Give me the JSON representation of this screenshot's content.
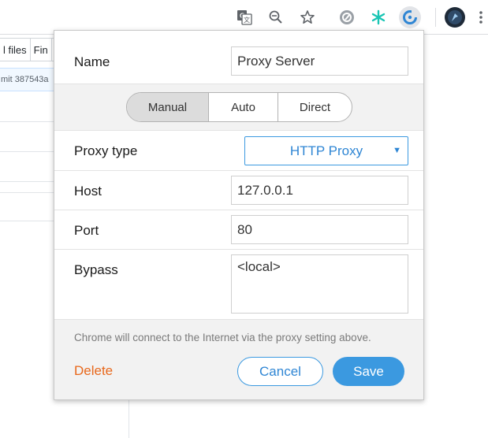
{
  "toolbar": {
    "icons": [
      "translate-icon",
      "zoom-out-icon",
      "bookmark-star-icon",
      "extension-icon",
      "extension-star-icon",
      "proxy-switch-icon",
      "profile-avatar",
      "menu-kebab-icon"
    ]
  },
  "background_page": {
    "tabs": [
      "l files",
      "Fin"
    ],
    "commit_text": "mit 387543a"
  },
  "popup": {
    "name_label": "Name",
    "name_value": "Proxy Server",
    "modes": [
      "Manual",
      "Auto",
      "Direct"
    ],
    "active_mode": "Manual",
    "proxy_type_label": "Proxy type",
    "proxy_type_value": "HTTP Proxy",
    "host_label": "Host",
    "host_value": "127.0.0.1",
    "port_label": "Port",
    "port_value": "80",
    "bypass_label": "Bypass",
    "bypass_value": "<local>",
    "note": "Chrome will connect to the Internet via the proxy setting above.",
    "delete_label": "Delete",
    "cancel_label": "Cancel",
    "save_label": "Save"
  },
  "colors": {
    "accent": "#3b99e0",
    "delete": "#e8681c",
    "panel_bg": "#f2f2f2"
  }
}
